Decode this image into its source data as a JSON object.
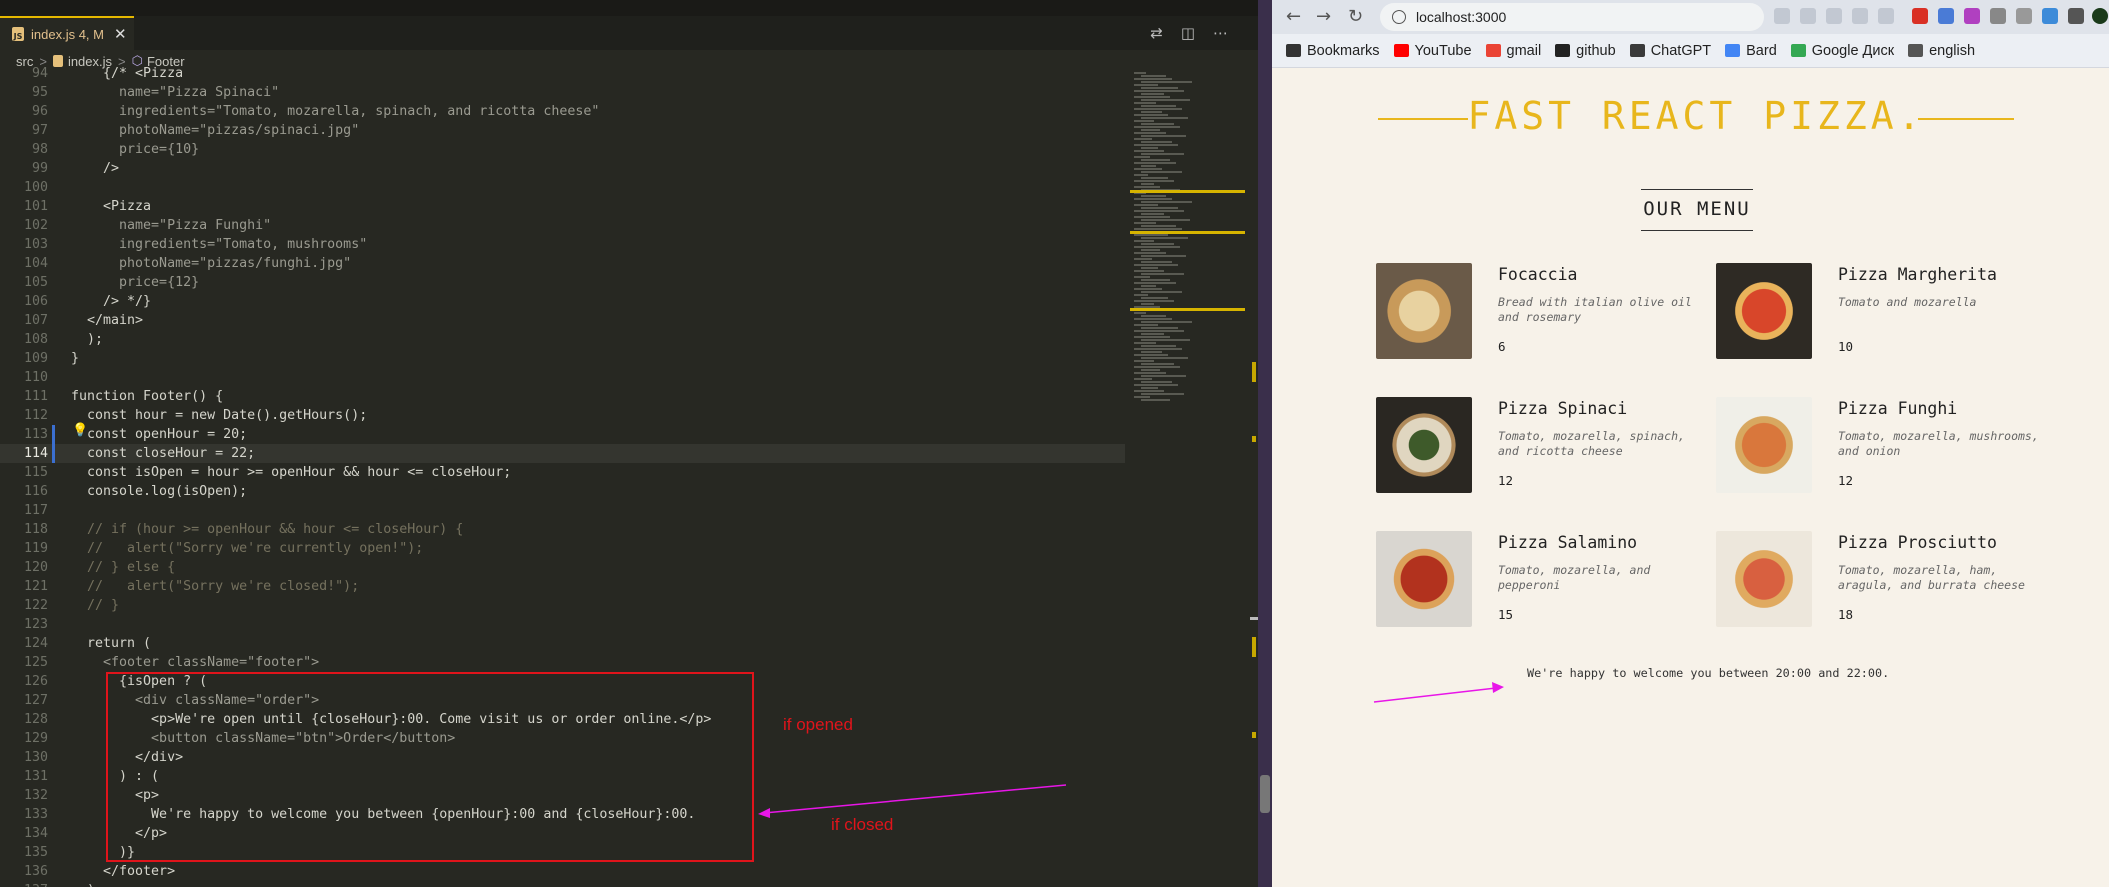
{
  "editor": {
    "tab": {
      "label": "index.js 4, M",
      "close": "✕"
    },
    "breadcrumb": {
      "src": "src",
      "file": "index.js",
      "symbol": "Footer",
      "sep": ">"
    },
    "current_line": 114,
    "lines": [
      {
        "n": "94",
        "t": "    {/* <Pizza"
      },
      {
        "n": "95",
        "t": "      name=\"Pizza Spinaci\""
      },
      {
        "n": "96",
        "t": "      ingredients=\"Tomato, mozarella, spinach, and ricotta cheese\""
      },
      {
        "n": "97",
        "t": "      photoName=\"pizzas/spinaci.jpg\""
      },
      {
        "n": "98",
        "t": "      price={10}"
      },
      {
        "n": "99",
        "t": "    />"
      },
      {
        "n": "100",
        "t": ""
      },
      {
        "n": "101",
        "t": "    <Pizza"
      },
      {
        "n": "102",
        "t": "      name=\"Pizza Funghi\""
      },
      {
        "n": "103",
        "t": "      ingredients=\"Tomato, mushrooms\""
      },
      {
        "n": "104",
        "t": "      photoName=\"pizzas/funghi.jpg\""
      },
      {
        "n": "105",
        "t": "      price={12}"
      },
      {
        "n": "106",
        "t": "    /> */}"
      },
      {
        "n": "107",
        "t": "  </main>"
      },
      {
        "n": "108",
        "t": "  );"
      },
      {
        "n": "109",
        "t": "}"
      },
      {
        "n": "110",
        "t": ""
      },
      {
        "n": "111",
        "t": "function Footer() {"
      },
      {
        "n": "112",
        "t": "  const hour = new Date().getHours();"
      },
      {
        "n": "113",
        "t": "  const openHour = 20;"
      },
      {
        "n": "114",
        "t": "  const closeHour = 22;"
      },
      {
        "n": "115",
        "t": "  const isOpen = hour >= openHour && hour <= closeHour;"
      },
      {
        "n": "116",
        "t": "  console.log(isOpen);"
      },
      {
        "n": "117",
        "t": ""
      },
      {
        "n": "118",
        "t": "  // if (hour >= openHour && hour <= closeHour) {"
      },
      {
        "n": "119",
        "t": "  //   alert(\"Sorry we're currently open!\");"
      },
      {
        "n": "120",
        "t": "  // } else {"
      },
      {
        "n": "121",
        "t": "  //   alert(\"Sorry we're closed!\");"
      },
      {
        "n": "122",
        "t": "  // }"
      },
      {
        "n": "123",
        "t": ""
      },
      {
        "n": "124",
        "t": "  return ("
      },
      {
        "n": "125",
        "t": "    <footer className=\"footer\">"
      },
      {
        "n": "126",
        "t": "      {isOpen ? ("
      },
      {
        "n": "127",
        "t": "        <div className=\"order\">"
      },
      {
        "n": "128",
        "t": "          <p>We're open until {closeHour}:00. Come visit us or order online.</p>"
      },
      {
        "n": "129",
        "t": "          <button className=\"btn\">Order</button>"
      },
      {
        "n": "130",
        "t": "        </div>"
      },
      {
        "n": "131",
        "t": "      ) : ("
      },
      {
        "n": "132",
        "t": "        <p>"
      },
      {
        "n": "133",
        "t": "          We're happy to welcome you between {openHour}:00 and {closeHour}:00."
      },
      {
        "n": "134",
        "t": "        </p>"
      },
      {
        "n": "135",
        "t": "      )}"
      },
      {
        "n": "136",
        "t": "    </footer>"
      },
      {
        "n": "137",
        "t": "  );"
      }
    ],
    "annotations": {
      "opened": "if opened",
      "closed": "if closed"
    }
  },
  "browser": {
    "url": "localhost:3000",
    "bookmarks": [
      {
        "label": "Bookmarks",
        "icon": "star-icon",
        "color": "#333333"
      },
      {
        "label": "YouTube",
        "icon": "youtube-icon",
        "color": "#ff0000"
      },
      {
        "label": "gmail",
        "icon": "gmail-icon",
        "color": "#ea4335"
      },
      {
        "label": "github",
        "icon": "github-icon",
        "color": "#222222"
      },
      {
        "label": "ChatGPT",
        "icon": "chatgpt-icon",
        "color": "#3a3a3a"
      },
      {
        "label": "Bard",
        "icon": "bard-icon",
        "color": "#4285f4"
      },
      {
        "label": "Google Диск",
        "icon": "google-drive-icon",
        "color": "#34a853"
      },
      {
        "label": "english",
        "icon": "folder-icon",
        "color": "#555555"
      }
    ],
    "page": {
      "title": "FAST REACT PIZZA.",
      "menu_heading": "OUR MENU",
      "pizzas": [
        {
          "name": "Focaccia",
          "ingredients": "Bread with italian olive oil and rosemary",
          "price": "6",
          "img": "focaccia"
        },
        {
          "name": "Pizza Margherita",
          "ingredients": "Tomato and mozarella",
          "price": "10",
          "img": "margherita"
        },
        {
          "name": "Pizza Spinaci",
          "ingredients": "Tomato, mozarella, spinach, and ricotta cheese",
          "price": "12",
          "img": "spinaci"
        },
        {
          "name": "Pizza Funghi",
          "ingredients": "Tomato, mozarella, mushrooms, and onion",
          "price": "12",
          "img": "funghi"
        },
        {
          "name": "Pizza Salamino",
          "ingredients": "Tomato, mozarella, and pepperoni",
          "price": "15",
          "img": "salamino"
        },
        {
          "name": "Pizza Prosciutto",
          "ingredients": "Tomato, mozarella, ham, aragula, and burrata cheese",
          "price": "18",
          "img": "prosciutto"
        }
      ],
      "footer_message": "We're happy to welcome you between 20:00 and 22:00."
    }
  },
  "colors": {
    "accent": "#e8b61c",
    "annotation_red": "#e0141b",
    "annotation_magenta": "#e816e8"
  }
}
